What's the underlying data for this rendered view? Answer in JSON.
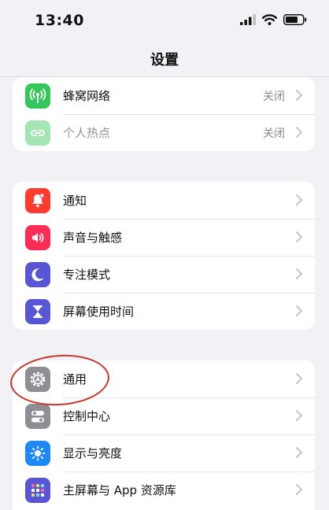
{
  "status_bar": {
    "time": "13:40"
  },
  "nav": {
    "title": "设置"
  },
  "groups": [
    {
      "items": [
        {
          "label": "蜂窝网络",
          "value": "关闭",
          "icon": "antenna-icon",
          "color": "#34c759"
        },
        {
          "label": "个人热点",
          "value": "关闭",
          "icon": "hotspot-icon",
          "color": "#34c759"
        }
      ]
    },
    {
      "items": [
        {
          "label": "通知",
          "icon": "bell-icon",
          "color": "#ff3b30"
        },
        {
          "label": "声音与触感",
          "icon": "speaker-icon",
          "color": "#ff2d55"
        },
        {
          "label": "专注模式",
          "icon": "moon-icon",
          "color": "#5856d6"
        },
        {
          "label": "屏幕使用时间",
          "icon": "hourglass-icon",
          "color": "#5856d6"
        }
      ]
    },
    {
      "items": [
        {
          "label": "通用",
          "icon": "gear-icon",
          "color": "#8e8e93"
        },
        {
          "label": "控制中心",
          "icon": "toggles-icon",
          "color": "#8e8e93"
        },
        {
          "label": "显示与亮度",
          "icon": "sun-icon",
          "color": "#1e88f5"
        },
        {
          "label": "主屏幕与 App 资源库",
          "icon": "home-grid-icon",
          "color": "#5856d6"
        }
      ]
    }
  ],
  "annotation": {
    "color": "#c8332c"
  }
}
